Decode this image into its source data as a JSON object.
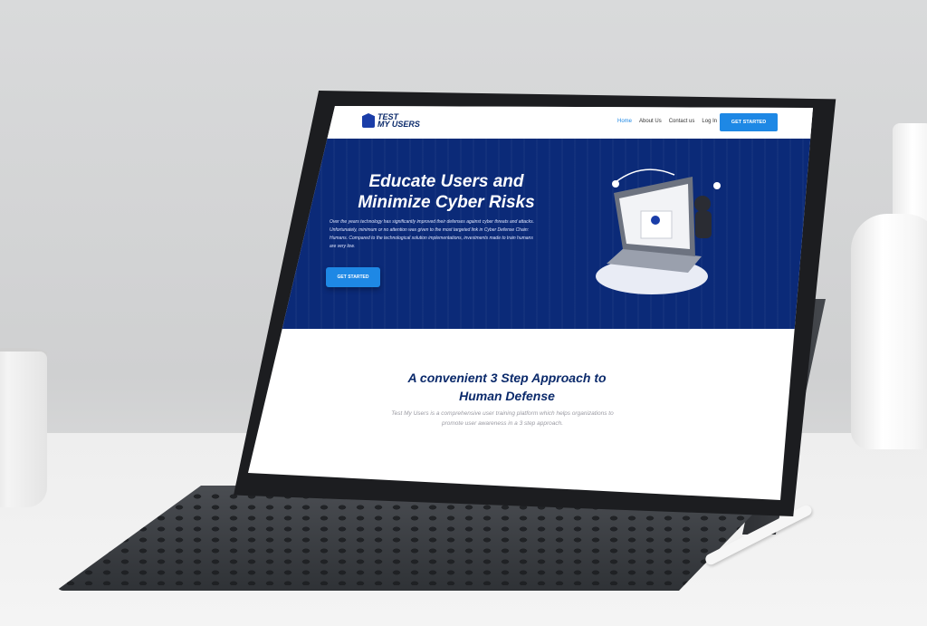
{
  "nav": {
    "logo_line1": "TEST",
    "logo_line2": "MY USERS",
    "links": [
      "Home",
      "About Us",
      "Contact us",
      "Log In"
    ],
    "active_link": "Home",
    "cta_label": "GET STARTED"
  },
  "hero": {
    "title_line1": "Educate Users and",
    "title_line2": "Minimize Cyber Risks",
    "body": "Over the years technology has significantly improved their defenses against cyber threats and attacks. Unfortunately, minimum or no attention was given to the most targeted link in Cyber Defense Chain: Humans. Compared to the technological solution implementations, investments made to train humans are very low.",
    "cta_label": "GET STARTED"
  },
  "section": {
    "title_line1": "A convenient 3 Step Approach to",
    "title_line2": "Human Defense",
    "body": "Test My Users is a comprehensive user training platform which helps organizations to promote user awareness in a 3 step approach."
  },
  "colors": {
    "brand_navy": "#0b2a78",
    "accent_blue": "#1e88e5",
    "title_navy": "#0b2a6b"
  }
}
